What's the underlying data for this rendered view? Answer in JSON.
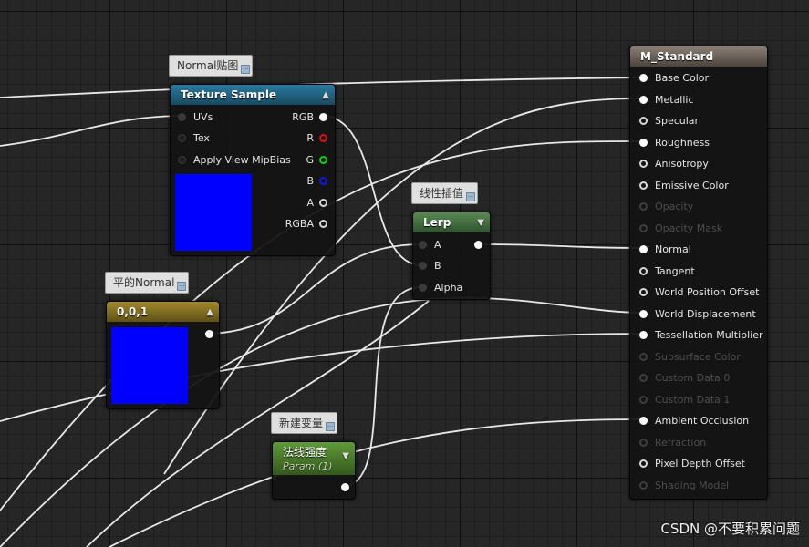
{
  "comments": {
    "normal_map": "Normal贴图",
    "flat_normal": "平的Normal",
    "lerp": "线性插值",
    "new_var": "新建变量"
  },
  "texture_sample": {
    "title": "Texture Sample",
    "inputs": [
      "UVs",
      "Tex",
      "Apply View MipBias"
    ],
    "outputs": [
      "RGB",
      "R",
      "G",
      "B",
      "A",
      "RGBA"
    ],
    "preview_color": "#0000ff"
  },
  "constant": {
    "title": "0,0,1",
    "preview_color": "#0000ff"
  },
  "lerp": {
    "title": "Lerp",
    "inputs": [
      "A",
      "B",
      "Alpha"
    ]
  },
  "param": {
    "title": "法线强度",
    "subtitle": "Param (1)"
  },
  "material": {
    "title": "M_Standard",
    "pins": [
      "Base Color",
      "Metallic",
      "Specular",
      "Roughness",
      "Anisotropy",
      "Emissive Color",
      "Opacity",
      "Opacity Mask",
      "Normal",
      "Tangent",
      "World Position Offset",
      "World Displacement",
      "Tessellation Multiplier",
      "Subsurface Color",
      "Custom Data 0",
      "Custom Data 1",
      "Ambient Occlusion",
      "Refraction",
      "Pixel Depth Offset",
      "Shading Model"
    ]
  },
  "watermark": "CSDN @不要积累问题",
  "colors": {
    "texture_header": "#1d5b78",
    "constant_header": "#7d6a1f",
    "lerp_header": "#3f6a3a",
    "param_header": "#4d7d2c",
    "material_header": "#6b625a",
    "wire": "#ffffff"
  }
}
